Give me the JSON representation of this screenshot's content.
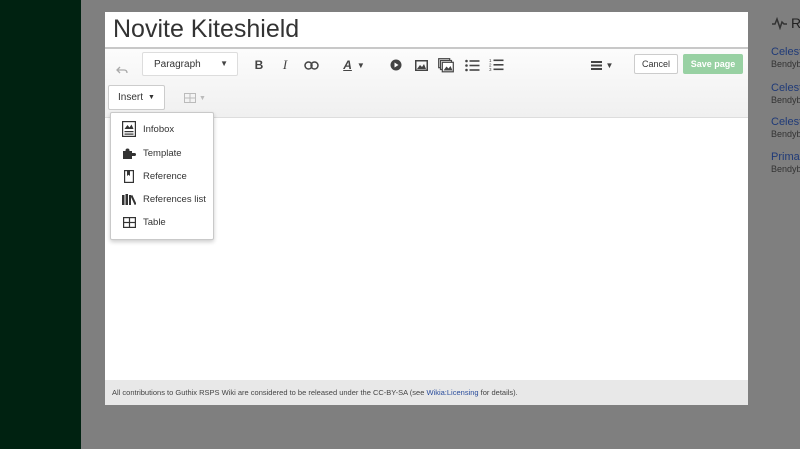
{
  "page": {
    "title": "Novite Kiteshield"
  },
  "toolbar": {
    "paragraph_label": "Paragraph",
    "bold_label": "B",
    "italic_label": "I",
    "text_style_label": "A",
    "cancel_label": "Cancel",
    "save_label": "Save page",
    "insert_label": "Insert"
  },
  "insert_menu": {
    "items": [
      {
        "label": "Infobox",
        "icon": "infobox-icon"
      },
      {
        "label": "Template",
        "icon": "puzzle-icon"
      },
      {
        "label": "Reference",
        "icon": "bookmark-icon"
      },
      {
        "label": "References list",
        "icon": "books-icon"
      },
      {
        "label": "Table",
        "icon": "table-icon"
      }
    ]
  },
  "footer": {
    "text_before": "All contributions to Guthix RSPS Wiki are considered to be released under the CC-BY-SA (see ",
    "link": "Wikia:Licensing",
    "text_after": " for details)."
  },
  "right_panel": {
    "heading": "R",
    "items": [
      {
        "title": "Celest",
        "user": "Bendyb"
      },
      {
        "title": "Celest",
        "user": "Bendyb"
      },
      {
        "title": "Celest",
        "user": "Bendyb"
      },
      {
        "title": "Primal",
        "user": "Bendyb"
      }
    ]
  },
  "colors": {
    "save_button": "#98d1a3",
    "left_rail": "#002211",
    "link": "#2a4d9c"
  }
}
